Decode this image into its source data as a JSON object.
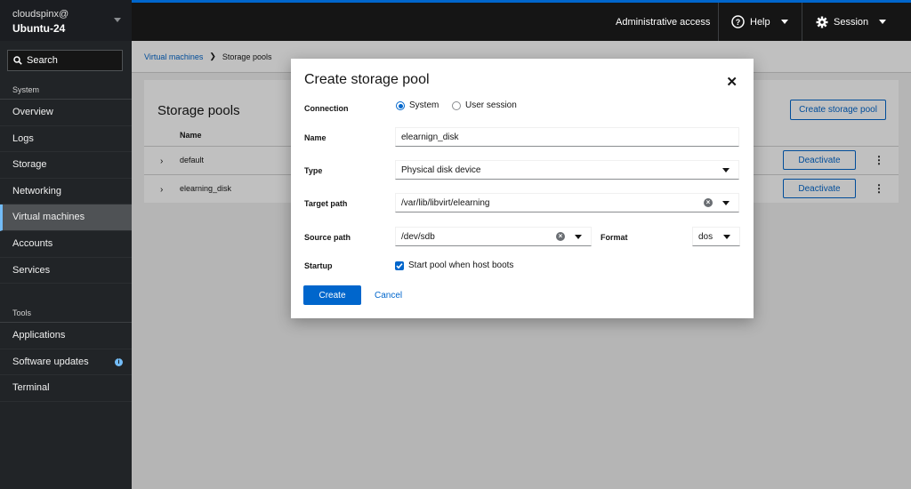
{
  "sidebar": {
    "user": "cloudspinx@",
    "host": "Ubuntu-24",
    "search_label": "Search",
    "system_heading": "System",
    "system_items": [
      {
        "label": "Overview"
      },
      {
        "label": "Logs"
      },
      {
        "label": "Storage"
      },
      {
        "label": "Networking"
      },
      {
        "label": "Virtual machines",
        "active": true
      },
      {
        "label": "Accounts"
      },
      {
        "label": "Services"
      }
    ],
    "tools_heading": "Tools",
    "tools_items": [
      {
        "label": "Applications"
      },
      {
        "label": "Software updates",
        "badge": "i"
      },
      {
        "label": "Terminal"
      }
    ]
  },
  "topbar": {
    "admin_access": "Administrative access",
    "help": "Help",
    "session": "Session"
  },
  "breadcrumb": {
    "parent": "Virtual machines",
    "current": "Storage pools"
  },
  "page": {
    "title": "Storage pools",
    "create_button": "Create storage pool",
    "column_name": "Name",
    "rows": [
      {
        "name": "default",
        "action": "Deactivate"
      },
      {
        "name": "elearning_disk",
        "action": "Deactivate"
      }
    ]
  },
  "modal": {
    "title": "Create storage pool",
    "connection_label": "Connection",
    "connection_options": [
      "System",
      "User session"
    ],
    "connection_selected": "System",
    "name_label": "Name",
    "name_value": "elearnign_disk",
    "type_label": "Type",
    "type_value": "Physical disk device",
    "target_label": "Target path",
    "target_value": "/var/lib/libvirt/elearning",
    "source_label": "Source path",
    "source_value": "/dev/sdb",
    "format_label": "Format",
    "format_value": "dos",
    "startup_label": "Startup",
    "startup_checkbox": "Start pool when host boots",
    "startup_checked": true,
    "create_button": "Create",
    "cancel_button": "Cancel"
  },
  "colors": {
    "accent": "#0066cc",
    "sidebar_bg": "#212427",
    "topbar_bg": "#151515",
    "active_indicator": "#73bcf7"
  }
}
